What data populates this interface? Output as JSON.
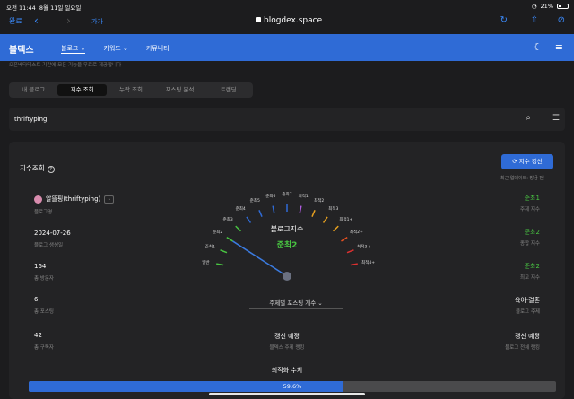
{
  "status": {
    "time": "오전 11:44",
    "date": "8월 11일 일요일",
    "battery": "21%"
  },
  "browser": {
    "done": "완료",
    "aa": "가가",
    "url": "blogdex.space"
  },
  "app": {
    "brand": "블덱스",
    "nav": [
      "블로그",
      "키워드",
      "커뮤니티"
    ]
  },
  "notice": "오픈베타테스트 기간에 모든 기능을 무료로 제공합니다",
  "tabs": [
    "내 블로그",
    "지수 조회",
    "누락 조회",
    "포스팅 분석",
    "트렌딩"
  ],
  "active_tab": 1,
  "search": {
    "value": "thriftyping"
  },
  "card": {
    "title": "지수조회",
    "refresh_button": "지수 갱신",
    "refresh_note": "최근 업데이트: 방금 전",
    "left": [
      {
        "value": "알뜰핑(thriftyping)",
        "label": "블로그명"
      },
      {
        "value": "2024-07-26",
        "label": "블로그 생성일"
      },
      {
        "value": "164",
        "label": "총 방문자"
      },
      {
        "value": "6",
        "label": "총 포스팅"
      },
      {
        "value": "42",
        "label": "총 구독자"
      }
    ],
    "right": [
      {
        "value": "준최1",
        "label": "주제 지수",
        "color": "#49c542"
      },
      {
        "value": "준최2",
        "label": "종합 지수",
        "color": "#49c542"
      },
      {
        "value": "준최2",
        "label": "최고 지수",
        "color": "#49c542"
      },
      {
        "value": "육아·결혼",
        "label": "블로그 주제",
        "color": "#ffffff"
      },
      {
        "value": "갱신 예정",
        "label": "블로그 전체 랭킹",
        "color": "#ffffff"
      }
    ],
    "gauge": {
      "title": "블로그지수",
      "value": "준최2",
      "ticks": [
        "일반",
        "준최1",
        "준최2",
        "준최3",
        "준최4",
        "준최5",
        "준최6",
        "준최7",
        "최적1",
        "최적2",
        "최적3",
        "최적1+",
        "최적2+",
        "최적3+",
        "최적4+"
      ],
      "tick_colors": [
        "#49c542",
        "#49c542",
        "#49c542",
        "#49c542",
        "#2f6bd6",
        "#2f6bd6",
        "#2f6bd6",
        "#2f6bd6",
        "#b05ce0",
        "#e6a020",
        "#e6a020",
        "#e6a020",
        "#e65020",
        "#e03030",
        "#e03030"
      ],
      "current_index": 2
    },
    "post_select": "주제별 포스팅 개수",
    "middle_rank": {
      "value": "갱신 예정",
      "label": "블덱스 주제 랭킹"
    },
    "opt_title": "최적화 수치",
    "opt_value": "59.6%",
    "opt_fraction": 0.596
  }
}
